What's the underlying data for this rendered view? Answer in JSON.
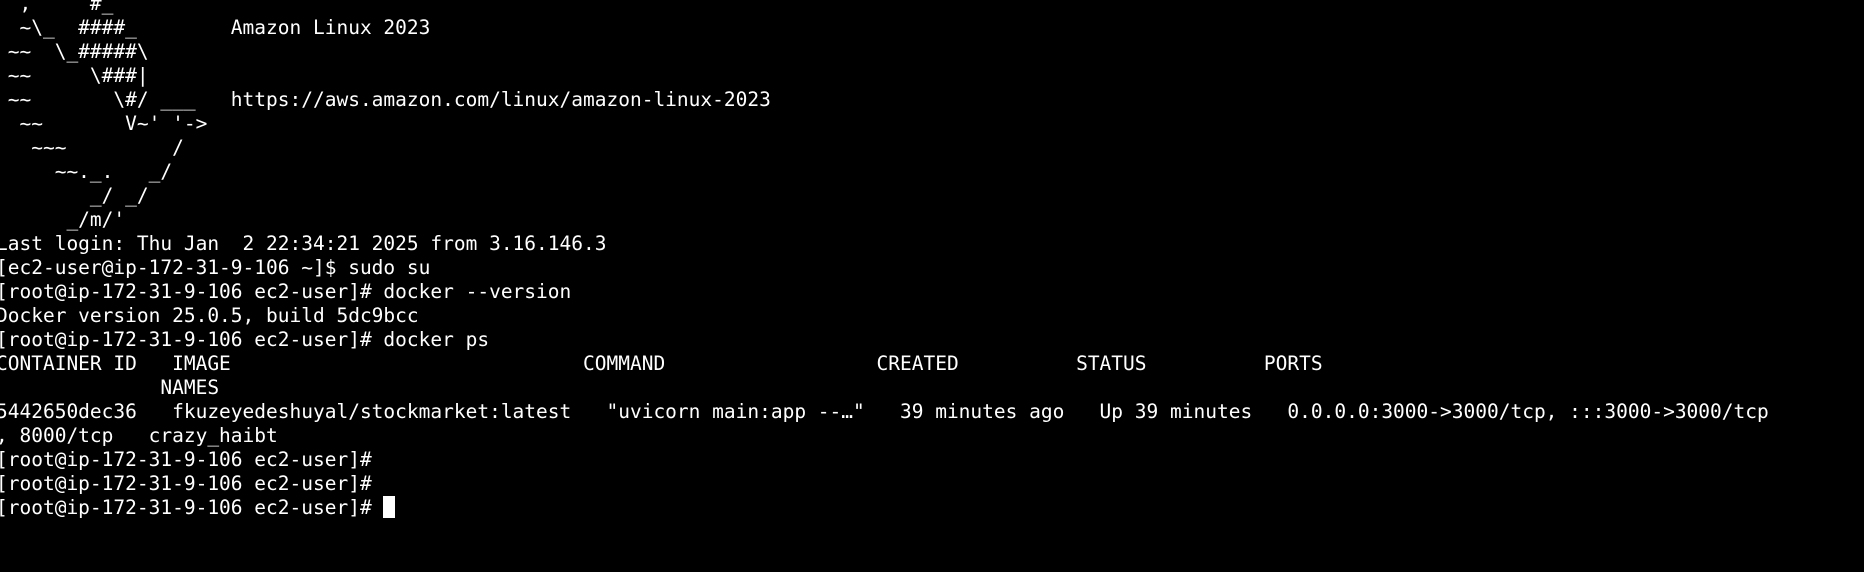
{
  "terminal": {
    "lines": [
      "  ,     #_",
      "  ~\\_  ####_        Amazon Linux 2023",
      " ~~  \\_#####\\",
      " ~~     \\###|",
      " ~~       \\#/ ___   https://aws.amazon.com/linux/amazon-linux-2023",
      "  ~~       V~' '->",
      "   ~~~         /",
      "     ~~._.   _/",
      "        _/ _/",
      "      _/m/'",
      "Last login: Thu Jan  2 22:34:21 2025 from 3.16.146.3",
      "[ec2-user@ip-172-31-9-106 ~]$ sudo su",
      "[root@ip-172-31-9-106 ec2-user]# docker --version",
      "Docker version 25.0.5, build 5dc9bcc",
      "[root@ip-172-31-9-106 ec2-user]# docker ps",
      "CONTAINER ID   IMAGE                              COMMAND                  CREATED          STATUS          PORTS",
      "              NAMES",
      "5442650dec36   fkuzeyedeshuyal/stockmarket:latest   \"uvicorn main:app --…\"   39 minutes ago   Up 39 minutes   0.0.0.0:3000->3000/tcp, :::3000->3000/tcp",
      ", 8000/tcp   crazy_haibt",
      "[root@ip-172-31-9-106 ec2-user]#",
      "[root@ip-172-31-9-106 ec2-user]#",
      "[root@ip-172-31-9-106 ec2-user]# "
    ]
  },
  "colors": {
    "background": "#000000",
    "foreground": "#ffffff"
  }
}
